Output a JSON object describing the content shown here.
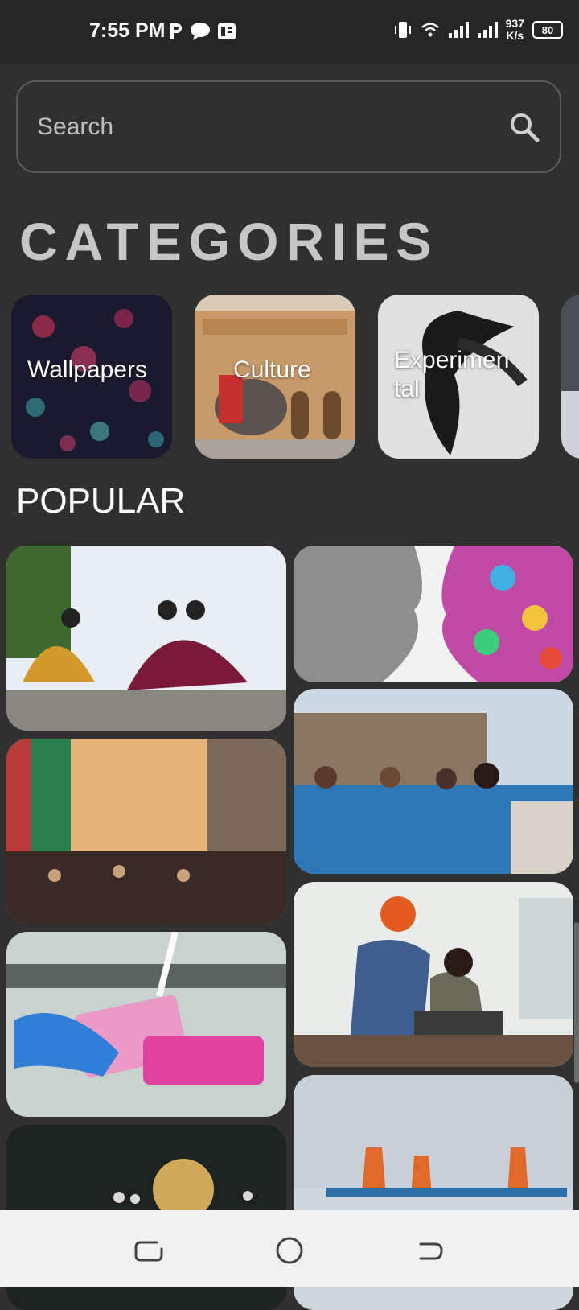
{
  "status_bar": {
    "time": "7:55 PM",
    "net_speed_value": "937",
    "net_speed_unit": "K/s",
    "battery": "80",
    "notification_icons": [
      "parking-p-icon",
      "chat-bubble-icon",
      "news-app-icon"
    ],
    "system_icons": [
      "vibrate-icon",
      "wifi-icon",
      "signal-icon",
      "signal-icon"
    ]
  },
  "search": {
    "placeholder": "Search",
    "value": "",
    "icon": "search-icon"
  },
  "categories": {
    "title": "CATEGORIES",
    "items": [
      {
        "label": "Wallpapers",
        "image": "jellyfish"
      },
      {
        "label": "Culture",
        "image": "palace-elephant"
      },
      {
        "label": "Experimen tal",
        "image": "black-wings"
      },
      {
        "label": "",
        "image": "snowy-forest"
      }
    ]
  },
  "popular": {
    "title": "POPULAR",
    "left_column": [
      {
        "image": "dancers-in-costume"
      },
      {
        "image": "street-market"
      },
      {
        "image": "lab-pipette"
      },
      {
        "image": "glowing-bulb"
      }
    ],
    "right_column": [
      {
        "image": "colorful-heads-profiles"
      },
      {
        "image": "friends-in-pool"
      },
      {
        "image": "people-with-tablet"
      },
      {
        "image": "port-cranes"
      }
    ]
  },
  "nav_bar": {
    "buttons": [
      "recents-icon",
      "home-icon",
      "back-icon"
    ]
  },
  "colors": {
    "background": "#303030",
    "status_bar": "#262626",
    "nav_bar": "#f1f1f1",
    "title_grey": "#c6c6c6"
  }
}
